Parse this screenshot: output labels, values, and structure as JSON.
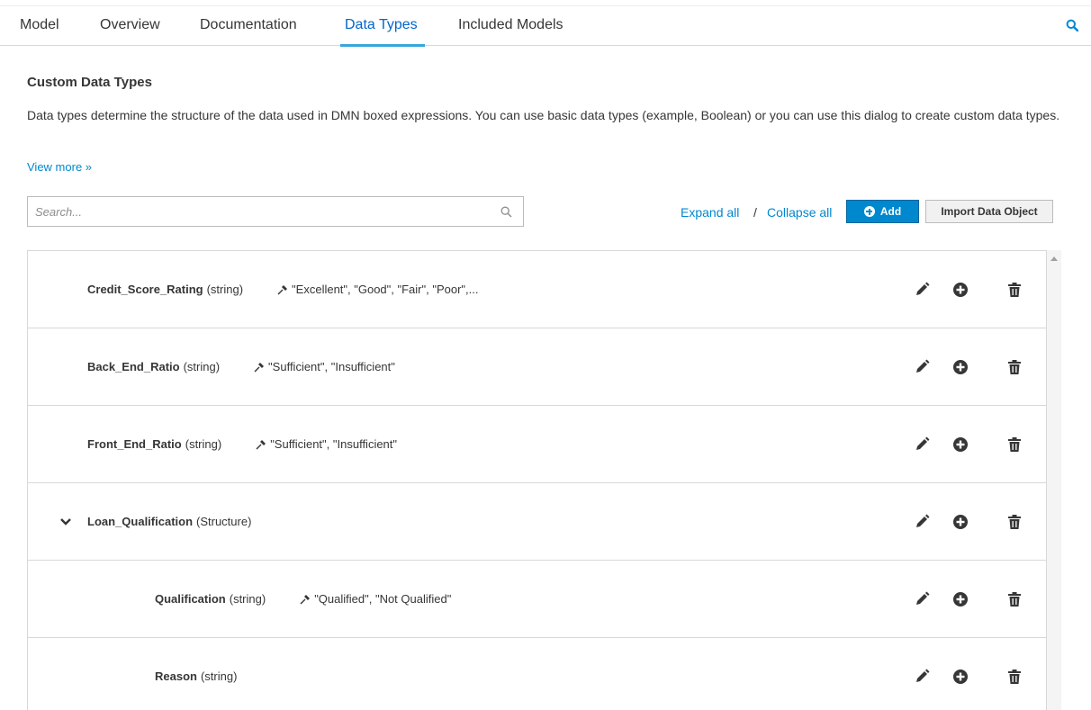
{
  "tabs": [
    {
      "label": "Model"
    },
    {
      "label": "Overview"
    },
    {
      "label": "Documentation"
    },
    {
      "label": "Data Types",
      "active": true
    },
    {
      "label": "Included Models"
    }
  ],
  "header": {
    "title": "Custom Data Types",
    "description": "Data types determine the structure of the data used in DMN boxed expressions. You can use basic data types (example, Boolean) or you can use this dialog to create custom data types.",
    "view_more": "View more »"
  },
  "toolbar": {
    "search_placeholder": "Search...",
    "expand_all": "Expand all",
    "separator": "/",
    "collapse_all": "Collapse all",
    "add_label": "Add",
    "import_label": "Import Data Object"
  },
  "rows": [
    {
      "name": "Credit_Score_Rating",
      "type": "(string)",
      "constraint": "\"Excellent\", \"Good\", \"Fair\", \"Poor\",..."
    },
    {
      "name": "Back_End_Ratio",
      "type": "(string)",
      "constraint": "\"Sufficient\", \"Insufficient\""
    },
    {
      "name": "Front_End_Ratio",
      "type": "(string)",
      "constraint": "\"Sufficient\", \"Insufficient\""
    },
    {
      "name": "Loan_Qualification",
      "type": "(Structure)",
      "constraint": "",
      "expanded": true
    },
    {
      "name": "Qualification",
      "type": "(string)",
      "constraint": "\"Qualified\", \"Not Qualified\"",
      "child": true
    },
    {
      "name": "Reason",
      "type": "(string)",
      "constraint": "",
      "child": true
    }
  ],
  "colors": {
    "accent": "#0088ce",
    "active_tab": "#0066cc",
    "border": "#d8d8d8"
  }
}
